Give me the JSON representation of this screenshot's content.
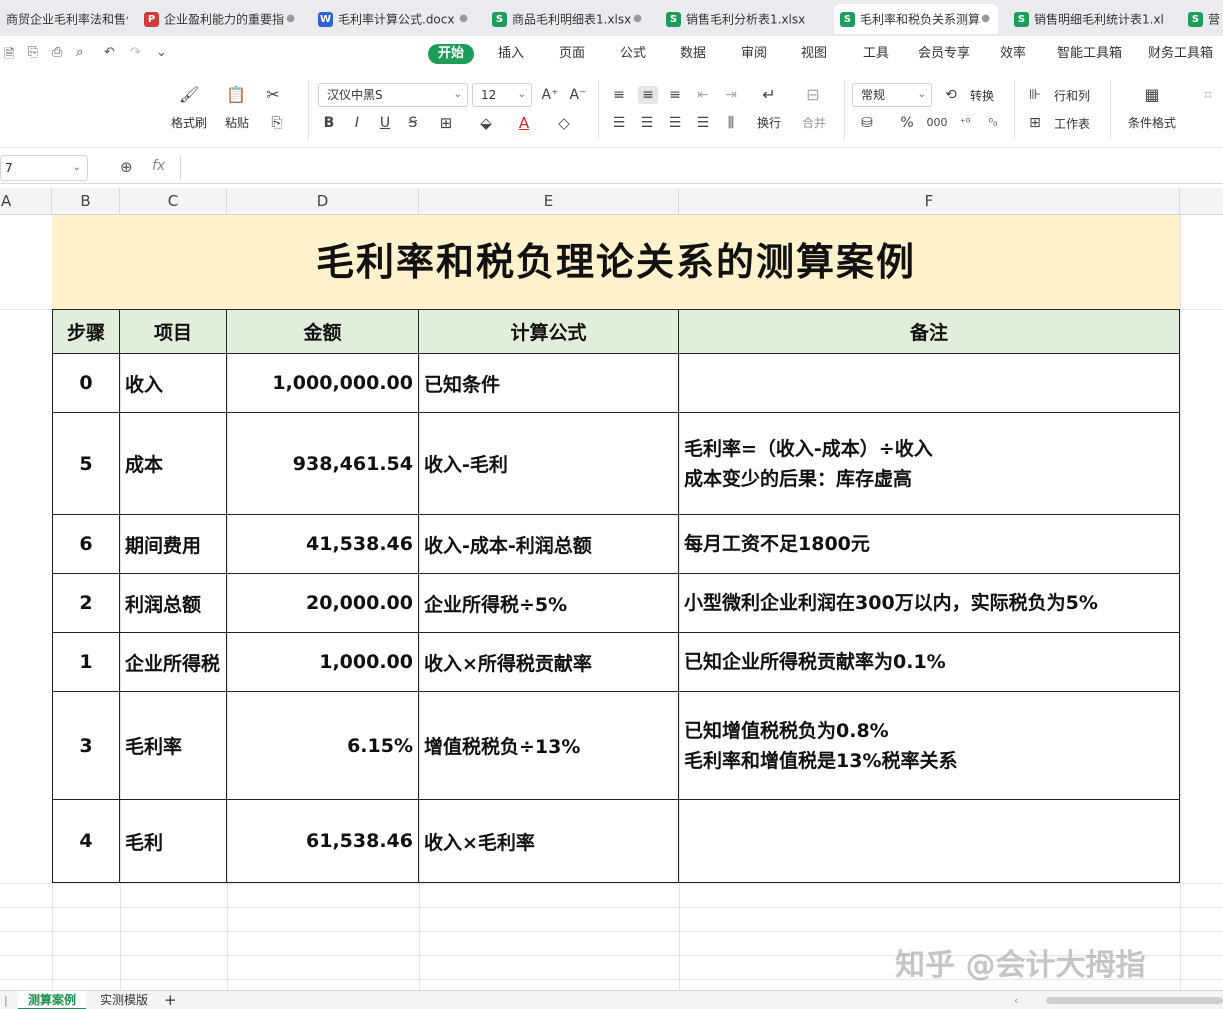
{
  "tabs": [
    {
      "label": "商贸企业毛利率法和售价",
      "icon": "",
      "color": ""
    },
    {
      "label": "企业盈利能力的重要指",
      "icon": "P",
      "color": "#d53a3a"
    },
    {
      "label": "毛利率计算公式.docx",
      "icon": "W",
      "color": "#2f64d6"
    },
    {
      "label": "商品毛利明细表1.xlsx",
      "icon": "S",
      "color": "#1e9c5a"
    },
    {
      "label": "销售毛利分析表1.xlsx",
      "icon": "S",
      "color": "#1e9c5a"
    },
    {
      "label": "毛利率和税负关系测算",
      "icon": "S",
      "color": "#1e9c5a"
    },
    {
      "label": "销售明细毛利统计表1.xl",
      "icon": "S",
      "color": "#1e9c5a"
    },
    {
      "label": "营",
      "icon": "S",
      "color": "#1e9c5a"
    }
  ],
  "menu": [
    "开始",
    "插入",
    "页面",
    "公式",
    "数据",
    "审阅",
    "视图",
    "工具",
    "会员专享",
    "效率",
    "智能工具箱",
    "财务工具箱"
  ],
  "ribbon": {
    "format_painter": "格式刷",
    "paste": "粘贴",
    "font_name": "汉仪中黑S",
    "font_size": "12",
    "wrap": "换行",
    "merge": "合并",
    "number_format": "常规",
    "convert": "转换",
    "row_col": "行和列",
    "worksheet": "工作表",
    "cond_format": "条件格式"
  },
  "formula_bar": {
    "name_box": "7",
    "fx": "fx",
    "content": ""
  },
  "columns": [
    "A",
    "B",
    "C",
    "D",
    "E",
    "F"
  ],
  "sheet": {
    "title": "毛利率和税负理论关系的测算案例",
    "headers": [
      "步骤",
      "项目",
      "金额",
      "计算公式",
      "备注"
    ],
    "rows": [
      {
        "step": "0",
        "item": "收入",
        "amount": "1,000,000.00",
        "formula": "已知条件",
        "note": [
          ""
        ]
      },
      {
        "step": "5",
        "item": "成本",
        "amount": "938,461.54",
        "formula": "收入-毛利",
        "note": [
          "毛利率=（收入-成本）÷收入",
          "成本变少的后果：库存虚高"
        ]
      },
      {
        "step": "6",
        "item": "期间费用",
        "amount": "41,538.46",
        "formula": "收入-成本-利润总额",
        "note": [
          "每月工资不足1800元"
        ]
      },
      {
        "step": "2",
        "item": "利润总额",
        "amount": "20,000.00",
        "formula": "企业所得税÷5%",
        "note": [
          "小型微利企业利润在300万以内，实际税负为5%"
        ]
      },
      {
        "step": "1",
        "item": "企业所得税",
        "amount": "1,000.00",
        "formula": "收入×所得税贡献率",
        "note": [
          "已知企业所得税贡献率为0.1%"
        ]
      },
      {
        "step": "3",
        "item": "毛利率",
        "amount": "6.15%",
        "formula": "增值税税负÷13%",
        "note": [
          "已知增值税税负为0.8%",
          "毛利率和增值税是13%税率关系"
        ]
      },
      {
        "step": "4",
        "item": "毛利",
        "amount": "61,538.46",
        "formula": "收入×毛利率",
        "note": [
          ""
        ]
      }
    ]
  },
  "sheet_tabs": [
    "测算案例",
    "实测模版"
  ],
  "watermark": "知乎 @会计大拇指"
}
